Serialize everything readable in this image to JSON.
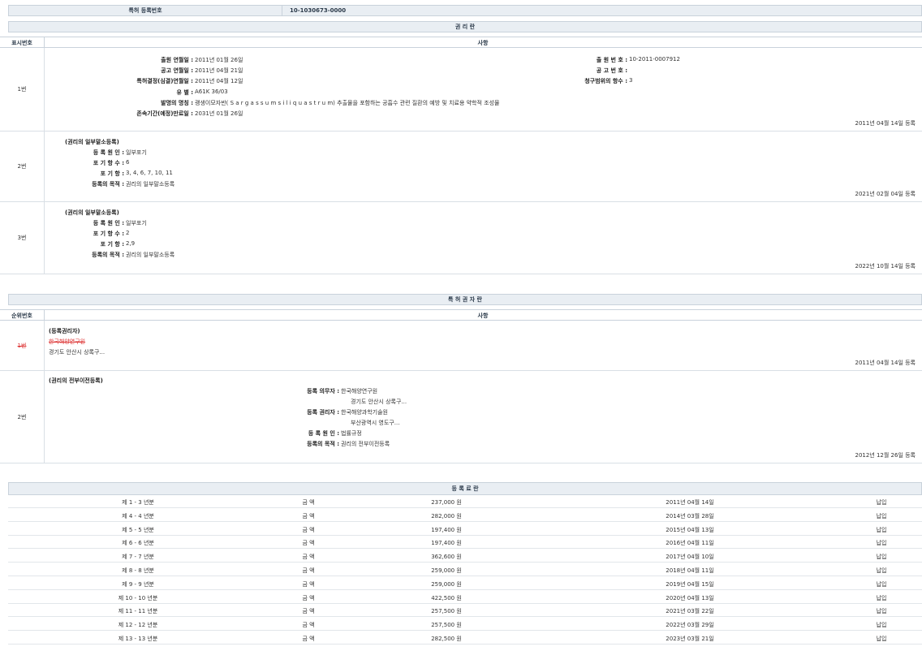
{
  "registration": {
    "label": "특허 등록번호",
    "value": "10-1030673-0000"
  },
  "rights_section": {
    "title": "권 리 란",
    "col_num": "표시번호",
    "col_desc": "사항",
    "entry1": {
      "num": "1번",
      "fields": [
        {
          "k": "출원 연월일 :",
          "v": "2011년 01월 26일"
        },
        {
          "k": "공고 연월일 :",
          "v": "2011년 04월 21일"
        },
        {
          "k": "특허결정(심결)연월일 :",
          "v": "2011년 04월 12일"
        },
        {
          "k": "유 별 :",
          "v": "A61K 36/03"
        },
        {
          "k": "발명의 명칭 :",
          "v": "괭생이모자반( S a r g a s s u m s i l i q u a s t r u m) 추출물을 포함하는 공흡수 관련 질환의 예방 및 치료용 약학적 조성물"
        },
        {
          "k": "존속기간(예정)만료일 :",
          "v": "2031년 01월 26일"
        }
      ],
      "right_fields": [
        {
          "k": "출 원 번 호 :",
          "v": "10-2011-0007912"
        },
        {
          "k": "공 고 번 호 :",
          "v": ""
        },
        {
          "k": "청구범위의 항수 :",
          "v": "3"
        }
      ],
      "date": "2011년 04월 14일 등록"
    },
    "entry2": {
      "num": "2번",
      "heading": "(권리의 일부말소등록)",
      "fields": [
        {
          "k": "등 록 원 인 :",
          "v": "일부포기"
        },
        {
          "k": "포 기 항 수 :",
          "v": "6"
        },
        {
          "k": "포 기 항 :",
          "v": "3, 4, 6, 7, 10, 11"
        },
        {
          "k": "등록의 목적 :",
          "v": "권리의 일부말소등록"
        }
      ],
      "date": "2021년 02월 04일 등록"
    },
    "entry3": {
      "num": "3번",
      "heading": "(권리의 일부말소등록)",
      "fields": [
        {
          "k": "등 록 원 인 :",
          "v": "일부포기"
        },
        {
          "k": "포 기 항 수 :",
          "v": "2"
        },
        {
          "k": "포 기 항 :",
          "v": "2,9"
        },
        {
          "k": "등록의 목적 :",
          "v": "권리의 일부말소등록"
        }
      ],
      "date": "2022년 10월 14일 등록"
    }
  },
  "holder_section": {
    "title": "특 허 권 자 란",
    "col_num": "순위번호",
    "col_desc": "사항",
    "entry1": {
      "num": "1번",
      "heading": "(등록권리자)",
      "name": "한국해양연구원",
      "address": "경기도 안산시 상록구...",
      "date": "2011년 04월 14일 등록"
    },
    "entry2": {
      "num": "2번",
      "heading": "(권리의 전부이전등록)",
      "obligor_k": "등록 의무자 :",
      "obligor_name": "한국해양연구원",
      "obligor_addr": "경기도 안산시 상록구...",
      "holder_k": "등록 권리자 :",
      "holder_name": "한국해양과학기술원",
      "holder_addr": "부산광역시 영도구...",
      "cause_k": "등 록 원 인 :",
      "cause_v": "법률규정",
      "purpose_k": "등록의 목적 :",
      "purpose_v": "권리의 전부이전등록",
      "date": "2012년 12월 26일 등록"
    }
  },
  "fee_section": {
    "title": "등 록 료 란",
    "rows": [
      {
        "year": "제 1 - 3 년분",
        "label": "금 액",
        "amount": "237,000 원",
        "date": "2011년 04월 14일",
        "status": "납입"
      },
      {
        "year": "제 4 - 4 년분",
        "label": "금 액",
        "amount": "282,000 원",
        "date": "2014년 03월 28일",
        "status": "납입"
      },
      {
        "year": "제 5 - 5 년분",
        "label": "금 액",
        "amount": "197,400 원",
        "date": "2015년 04월 13일",
        "status": "납입"
      },
      {
        "year": "제 6 - 6 년분",
        "label": "금 액",
        "amount": "197,400 원",
        "date": "2016년 04월 11일",
        "status": "납입"
      },
      {
        "year": "제 7 - 7 년분",
        "label": "금 액",
        "amount": "362,600 원",
        "date": "2017년 04월 10일",
        "status": "납입"
      },
      {
        "year": "제 8 - 8 년분",
        "label": "금 액",
        "amount": "259,000 원",
        "date": "2018년 04월 11일",
        "status": "납입"
      },
      {
        "year": "제 9 - 9 년분",
        "label": "금 액",
        "amount": "259,000 원",
        "date": "2019년 04월 15일",
        "status": "납입"
      },
      {
        "year": "제 10 - 10 년분",
        "label": "금 액",
        "amount": "422,500 원",
        "date": "2020년 04월 13일",
        "status": "납입"
      },
      {
        "year": "제 11 - 11 년분",
        "label": "금 액",
        "amount": "257,500 원",
        "date": "2021년 03월 22일",
        "status": "납입"
      },
      {
        "year": "제 12 - 12 년분",
        "label": "금 액",
        "amount": "257,500 원",
        "date": "2022년 03월 29일",
        "status": "납입"
      },
      {
        "year": "제 13 - 13 년분",
        "label": "금 액",
        "amount": "282,500 원",
        "date": "2023년 03월 21일",
        "status": "납입"
      }
    ]
  }
}
